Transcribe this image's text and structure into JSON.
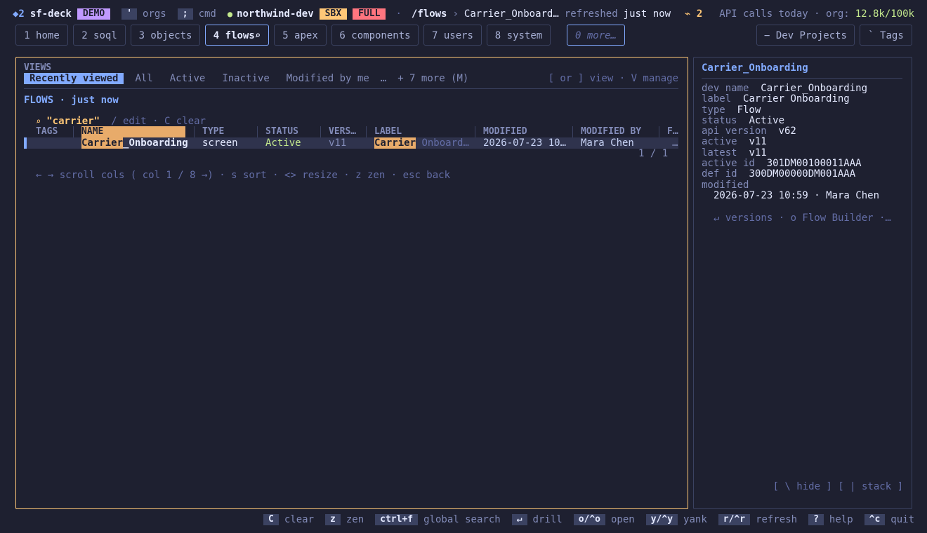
{
  "header": {
    "workspace": "◆2",
    "app_name": "sf-deck",
    "demo_badge": "DEMO",
    "orgs_key": "'",
    "orgs_label": "orgs",
    "cmd_key": ";",
    "cmd_label": "cmd",
    "org_dot": "●",
    "org_name": "northwind-dev",
    "sbx_badge": "SBX",
    "full_badge": "FULL",
    "middot": "·",
    "route": "/flows",
    "route_sep": "›",
    "route_item": "Carrier_Onboard…",
    "refreshed_label": "refreshed",
    "refreshed_value": "just now",
    "bolt_count": "⌁ 2",
    "api_label": "API calls today · org:",
    "api_value": "12.8k/100k"
  },
  "tabs": [
    {
      "label": "1 home"
    },
    {
      "label": "2 soql"
    },
    {
      "label": "3 objects"
    },
    {
      "label": "4 flows⌕"
    },
    {
      "label": "5 apex"
    },
    {
      "label": "6 components"
    },
    {
      "label": "7 users"
    },
    {
      "label": "8 system"
    },
    {
      "label": "0 more…"
    }
  ],
  "right_tabs": [
    {
      "label": "− Dev Projects"
    },
    {
      "label": "` Tags"
    }
  ],
  "views": {
    "title": "VIEWS",
    "items": [
      "Recently viewed",
      "All",
      "Active",
      "Inactive",
      "Modified by me",
      "…",
      "+ 7 more (M)"
    ],
    "hint": "[ or ] view · V manage"
  },
  "list": {
    "title": "FLOWS · just now",
    "filter_icon": "⌕",
    "filter_query": "\"carrier\"",
    "filter_hint": "/ edit · C clear",
    "columns": [
      "TAGS",
      "NAME",
      "TYPE",
      "STATUS",
      "VERS…",
      "LABEL",
      "MODIFIED",
      "MODIFIED BY",
      "F…"
    ],
    "row": {
      "name_match": "Carrier",
      "name_rest": "_Onboarding",
      "type": "screen",
      "status": "Active",
      "version": "v11",
      "label_match": "Carrier",
      "label_rest": "Onboard…",
      "modified": "2026-07-23 10…",
      "modified_by": "Mara Chen",
      "extra": "…"
    },
    "pager": "1 / 1",
    "hint": "← → scroll cols (  col 1 / 8 →) · s sort · <> resize · z zen · esc back"
  },
  "detail": {
    "title": "Carrier_Onboarding",
    "fields": [
      {
        "k": "dev name",
        "v": "Carrier_Onboarding"
      },
      {
        "k": "label",
        "v": "Carrier Onboarding"
      },
      {
        "k": "type",
        "v": "Flow"
      },
      {
        "k": "status",
        "v": "Active"
      },
      {
        "k": "api version",
        "v": "v62"
      },
      {
        "k": "active",
        "v": "v11"
      },
      {
        "k": "latest",
        "v": "v11"
      },
      {
        "k": "active id",
        "v": "301DM00100011AAA"
      },
      {
        "k": "def id",
        "v": "300DM00000DM001AAA"
      }
    ],
    "modified_label": "modified",
    "modified_value": "2026-07-23 10:59 · Mara Chen",
    "actions": "↵ versions  ·  o Flow Builder  ·…",
    "footer_hint": "[ \\ hide ] [ | stack ]"
  },
  "footer": [
    {
      "key": "C",
      "label": "clear"
    },
    {
      "key": "z",
      "label": "zen"
    },
    {
      "key": "ctrl+f",
      "label": "global search"
    },
    {
      "key": "↵",
      "label": "drill"
    },
    {
      "key": "o/^o",
      "label": "open"
    },
    {
      "key": "y/^y",
      "label": "yank"
    },
    {
      "key": "r/^r",
      "label": "refresh"
    },
    {
      "key": "?",
      "label": "help"
    },
    {
      "key": "^c",
      "label": "quit"
    }
  ],
  "colors": {
    "accent": "#82aaff",
    "highlight": "#e8ab6a",
    "focus_border": "#ffc777",
    "active_green": "#c3e88d",
    "demo_badge": "#c099ff",
    "sbx_badge": "#ffc777",
    "full_badge": "#ff757f"
  }
}
